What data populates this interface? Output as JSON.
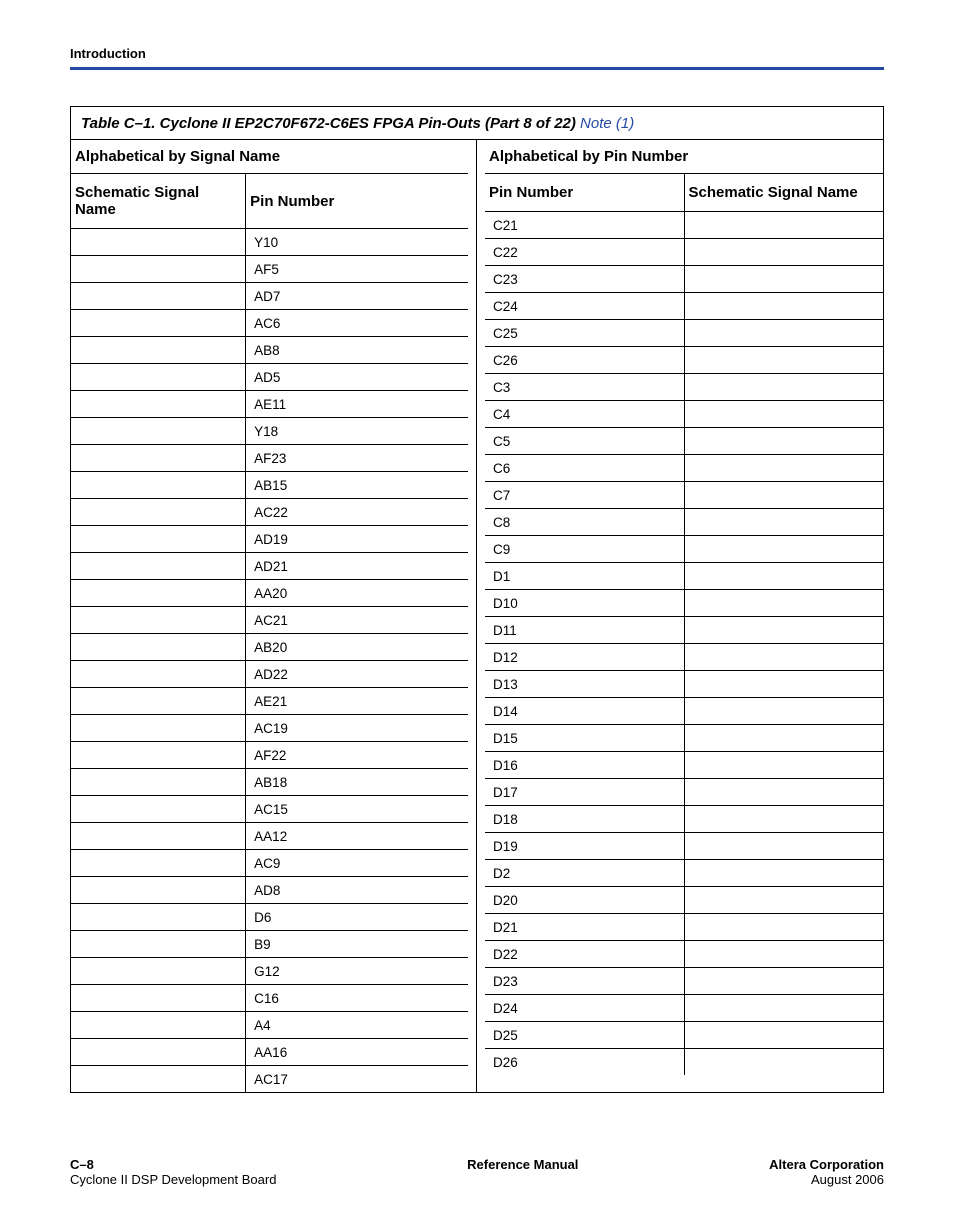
{
  "running_head": "Introduction",
  "table": {
    "caption_main": "Table C–1. Cyclone II EP2C70F672-C6ES FPGA Pin-Outs  (Part 8 of 22) ",
    "caption_note": "Note (1)",
    "left_group": "Alphabetical by Signal Name",
    "right_group": "Alphabetical by Pin Number",
    "left_sub1": "Schematic Signal Name",
    "left_sub2": "Pin Number",
    "right_sub1": "Pin Number",
    "right_sub2": "Schematic Signal Name",
    "left_rows": [
      {
        "sig": "",
        "pin": "Y10"
      },
      {
        "sig": "",
        "pin": "AF5"
      },
      {
        "sig": "",
        "pin": "AD7"
      },
      {
        "sig": "",
        "pin": "AC6"
      },
      {
        "sig": "",
        "pin": "AB8"
      },
      {
        "sig": "",
        "pin": "AD5"
      },
      {
        "sig": "",
        "pin": "AE11"
      },
      {
        "sig": "",
        "pin": "Y18"
      },
      {
        "sig": "",
        "pin": "AF23"
      },
      {
        "sig": "",
        "pin": "AB15"
      },
      {
        "sig": "",
        "pin": "AC22"
      },
      {
        "sig": "",
        "pin": "AD19"
      },
      {
        "sig": "",
        "pin": "AD21"
      },
      {
        "sig": "",
        "pin": "AA20"
      },
      {
        "sig": "",
        "pin": "AC21"
      },
      {
        "sig": "",
        "pin": "AB20"
      },
      {
        "sig": "",
        "pin": "AD22"
      },
      {
        "sig": "",
        "pin": "AE21"
      },
      {
        "sig": "",
        "pin": "AC19"
      },
      {
        "sig": "",
        "pin": "AF22"
      },
      {
        "sig": "",
        "pin": "AB18"
      },
      {
        "sig": "",
        "pin": "AC15"
      },
      {
        "sig": "",
        "pin": "AA12"
      },
      {
        "sig": "",
        "pin": "AC9"
      },
      {
        "sig": "",
        "pin": "AD8"
      },
      {
        "sig": "",
        "pin": "D6"
      },
      {
        "sig": "",
        "pin": "B9"
      },
      {
        "sig": "",
        "pin": "G12"
      },
      {
        "sig": "",
        "pin": "C16"
      },
      {
        "sig": "",
        "pin": "A4"
      },
      {
        "sig": "",
        "pin": "AA16"
      },
      {
        "sig": "",
        "pin": "AC17"
      }
    ],
    "right_rows": [
      {
        "pin": "C21",
        "sig": ""
      },
      {
        "pin": "C22",
        "sig": ""
      },
      {
        "pin": "C23",
        "sig": ""
      },
      {
        "pin": "C24",
        "sig": ""
      },
      {
        "pin": "C25",
        "sig": ""
      },
      {
        "pin": "C26",
        "sig": ""
      },
      {
        "pin": "C3",
        "sig": ""
      },
      {
        "pin": "C4",
        "sig": ""
      },
      {
        "pin": "C5",
        "sig": ""
      },
      {
        "pin": "C6",
        "sig": ""
      },
      {
        "pin": "C7",
        "sig": ""
      },
      {
        "pin": "C8",
        "sig": ""
      },
      {
        "pin": "C9",
        "sig": ""
      },
      {
        "pin": "D1",
        "sig": ""
      },
      {
        "pin": "D10",
        "sig": ""
      },
      {
        "pin": "D11",
        "sig": ""
      },
      {
        "pin": "D12",
        "sig": ""
      },
      {
        "pin": "D13",
        "sig": ""
      },
      {
        "pin": "D14",
        "sig": ""
      },
      {
        "pin": "D15",
        "sig": ""
      },
      {
        "pin": "D16",
        "sig": ""
      },
      {
        "pin": "D17",
        "sig": ""
      },
      {
        "pin": "D18",
        "sig": ""
      },
      {
        "pin": "D19",
        "sig": ""
      },
      {
        "pin": "D2",
        "sig": ""
      },
      {
        "pin": "D20",
        "sig": ""
      },
      {
        "pin": "D21",
        "sig": ""
      },
      {
        "pin": "D22",
        "sig": ""
      },
      {
        "pin": "D23",
        "sig": ""
      },
      {
        "pin": "D24",
        "sig": ""
      },
      {
        "pin": "D25",
        "sig": ""
      },
      {
        "pin": "D26",
        "sig": ""
      }
    ]
  },
  "footer": {
    "left_line1": "C–8",
    "left_line2": "Cyclone II DSP Development Board",
    "center": "Reference Manual",
    "right_line1": "Altera Corporation",
    "right_line2": "August 2006"
  }
}
